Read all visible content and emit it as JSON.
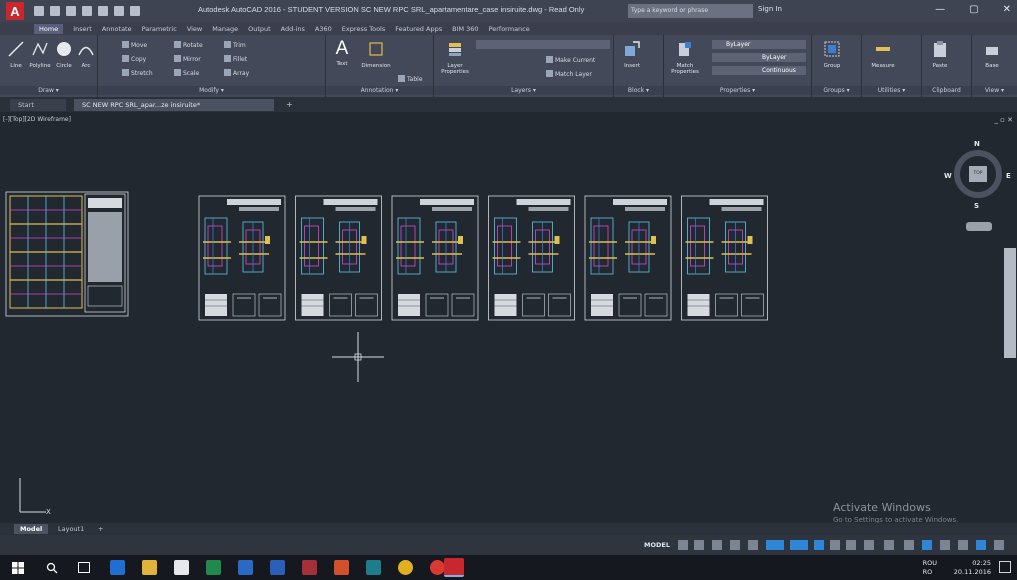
{
  "window": {
    "title": "Autodesk AutoCAD 2016 - STUDENT VERSION   SC NEW RPC SRL_apartamentare_case insiruite.dwg - Read Only",
    "search_placeholder": "Type a keyword or phrase",
    "signin": "Sign In",
    "controls": [
      "—",
      "▢",
      "✕"
    ]
  },
  "ribbon": {
    "tabs": [
      "Home",
      "Insert",
      "Annotate",
      "Parametric",
      "View",
      "Manage",
      "Output",
      "Add-ins",
      "A360",
      "Express Tools",
      "Featured Apps",
      "BIM 360",
      "Performance"
    ],
    "active_tab": "Home",
    "groups": {
      "draw": {
        "label": "Draw ▾",
        "tools": [
          "Line",
          "Polyline",
          "Circle",
          "Arc"
        ]
      },
      "modify": {
        "label": "Modify ▾",
        "tools": [
          "Move",
          "Rotate",
          "Trim",
          "Copy",
          "Mirror",
          "Fillet",
          "Stretch",
          "Scale",
          "Array"
        ]
      },
      "annotation": {
        "label": "Annotation ▾",
        "tools": [
          "Text",
          "Dimension",
          "Table"
        ]
      },
      "layers": {
        "label": "Layers ▾",
        "tools": [
          "Layer Properties",
          "Make Current",
          "Match Layer"
        ]
      },
      "block": {
        "label": "Block ▾",
        "tools": [
          "Insert"
        ]
      },
      "properties": {
        "label": "Properties ▾",
        "tools": [
          "Match Properties",
          "ByLayer",
          "ByLayer",
          "Continuous"
        ]
      },
      "groups": {
        "label": "Groups ▾",
        "tools": [
          "Group"
        ]
      },
      "utilities": {
        "label": "Utilities ▾",
        "tools": [
          "Measure"
        ]
      },
      "clipboard": {
        "label": "Clipboard",
        "tools": [
          "Paste"
        ]
      },
      "view": {
        "label": "View ▾",
        "tools": [
          "Base"
        ]
      }
    }
  },
  "doc_tabs": {
    "start": "Start",
    "document": "SC NEW RPC SRL_apar...ze insiruite*",
    "plus": "+"
  },
  "viewport": {
    "label": "[-][Top][2D Wireframe]",
    "controls": "_ ▫ ✕",
    "viewcube": {
      "n": "N",
      "s": "S",
      "e": "E",
      "w": "W",
      "top": "TOP"
    }
  },
  "sheets_count": 6,
  "watermark": {
    "line1": "Activate Windows",
    "line2": "Go to Settings to activate Windows."
  },
  "layout_tabs": [
    "Model",
    "Layout1",
    "+"
  ],
  "status": {
    "model": "MODEL"
  },
  "taskbar": {
    "apps": [
      "start",
      "search",
      "task-view",
      "edge",
      "explorer",
      "store",
      "excel",
      "outlook",
      "word",
      "access",
      "powerpoint",
      "publisher",
      "chrome",
      "chrome-2",
      "autocad"
    ],
    "lang": "ROU",
    "lang2": "RO",
    "time": "02:25",
    "date": "20.11.2016"
  },
  "colors": {
    "canvas": "#212830",
    "ribbon": "#44495a",
    "accent": "#2f86d6",
    "autocad_red": "#c8272d"
  }
}
